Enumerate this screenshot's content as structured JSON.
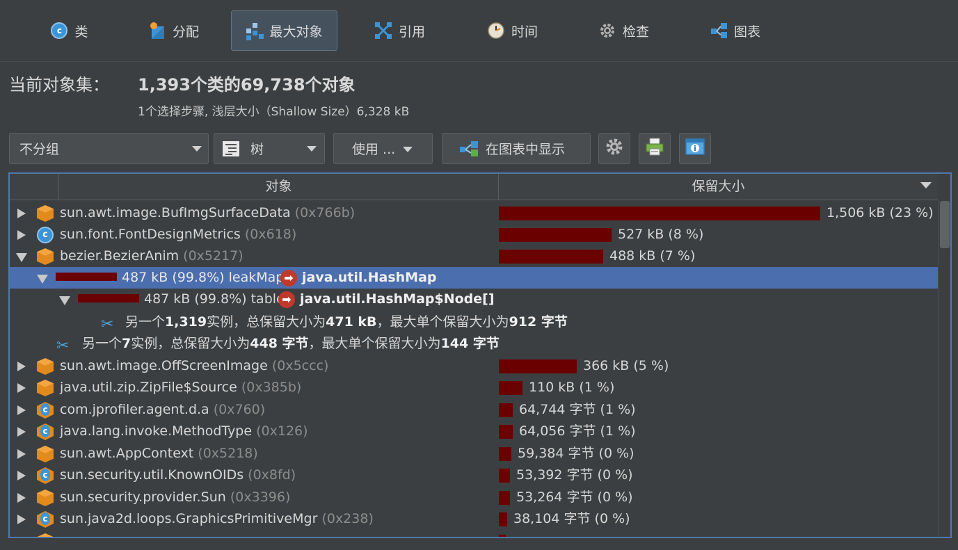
{
  "tabs": [
    {
      "label": "类",
      "icon": "class-icon"
    },
    {
      "label": "分配",
      "icon": "allocation-icon"
    },
    {
      "label": "最大对象",
      "icon": "biggest-objects-icon"
    },
    {
      "label": "引用",
      "icon": "references-icon"
    },
    {
      "label": "时间",
      "icon": "time-icon"
    },
    {
      "label": "检查",
      "icon": "inspection-icon"
    },
    {
      "label": "图表",
      "icon": "graph-icon"
    }
  ],
  "header": {
    "label": "当前对象集：",
    "value": "1,393个类的69,738个对象",
    "sub": "1个选择步骤, 浅层大小（Shallow Size）6,328 kB"
  },
  "toolbar": {
    "grouping": "不分组",
    "view": "树",
    "use": "使用 ...",
    "show_in_graph": "在图表中显示"
  },
  "table": {
    "col_object": "对象",
    "col_retained": "保留大小",
    "rows": [
      {
        "name": "sun.awt.image.BufImgSurfaceData",
        "addr": "(0x766b)",
        "icon": "cube",
        "value": "1,506 kB (23 %)",
        "fraction": 1.0
      },
      {
        "name": "sun.font.FontDesignMetrics",
        "addr": "(0x618)",
        "icon": "class",
        "value": "527 kB (8 %)",
        "fraction": 0.35
      },
      {
        "name": "bezier.BezierAnim",
        "addr": "(0x5217)",
        "icon": "cube",
        "value": "488 kB (7 %)",
        "fraction": 0.324
      },
      {
        "prefix": "487 kB (99.8%) leakMap",
        "target": "java.util.HashMap",
        "fraction": 0.998
      },
      {
        "prefix": "487 kB (99.8%) table",
        "target": "java.util.HashMap$Node[]",
        "fraction": 0.998
      },
      {
        "note_parts": [
          "另一个",
          "1,319",
          "实例，总保留大小为",
          "471 kB",
          "，最大单个保留大小为",
          "912 字节"
        ]
      },
      {
        "note_parts": [
          "另一个",
          "7",
          "实例，总保留大小为",
          "448 字节",
          "，最大单个保留大小为",
          "144 字节"
        ]
      },
      {
        "name": "sun.awt.image.OffScreenImage",
        "addr": "(0x5ccc)",
        "icon": "cube",
        "value": "366 kB (5 %)",
        "fraction": 0.243
      },
      {
        "name": "java.util.zip.ZipFile$Source",
        "addr": "(0x385b)",
        "icon": "cube",
        "value": "110 kB (1 %)",
        "fraction": 0.073
      },
      {
        "name": "com.jprofiler.agent.d.a",
        "addr": "(0x760)",
        "icon": "hex",
        "value": "64,744 字节 (1 %)",
        "fraction": 0.043
      },
      {
        "name": "java.lang.invoke.MethodType",
        "addr": "(0x126)",
        "icon": "hex",
        "value": "64,056 字节 (1 %)",
        "fraction": 0.0425
      },
      {
        "name": "sun.awt.AppContext",
        "addr": "(0x5218)",
        "icon": "cube",
        "value": "59,384 字节 (0 %)",
        "fraction": 0.0394
      },
      {
        "name": "sun.security.util.KnownOIDs",
        "addr": "(0x8fd)",
        "icon": "hex",
        "value": "53,392 字节 (0 %)",
        "fraction": 0.0354
      },
      {
        "name": "sun.security.provider.Sun",
        "addr": "(0x3396)",
        "icon": "cube",
        "value": "53,264 字节 (0 %)",
        "fraction": 0.0353
      },
      {
        "name": "sun.java2d.loops.GraphicsPrimitiveMgr",
        "addr": "(0x238)",
        "icon": "hex",
        "value": "38,104 字节 (0 %)",
        "fraction": 0.0253
      }
    ]
  }
}
